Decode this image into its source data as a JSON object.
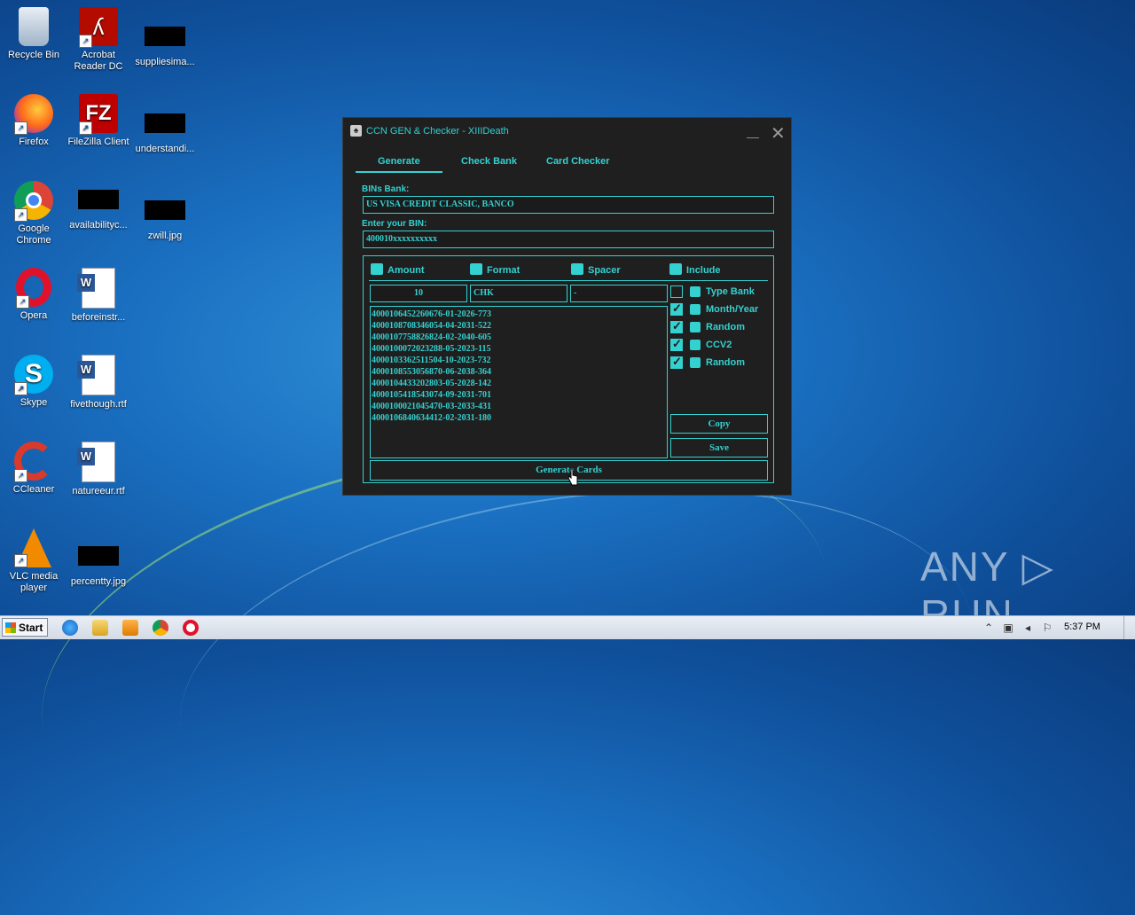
{
  "desktop": {
    "icons": [
      {
        "label": "Recycle Bin",
        "icon": "recycle-bin-icon"
      },
      {
        "label": "Acrobat Reader DC",
        "icon": "acrobat-icon"
      },
      {
        "label": "suppliesima...",
        "icon": "image-file-icon"
      },
      {
        "label": "Firefox",
        "icon": "firefox-icon"
      },
      {
        "label": "FileZilla Client",
        "icon": "filezilla-icon"
      },
      {
        "label": "understandi...",
        "icon": "image-file-icon"
      },
      {
        "label": "Google Chrome",
        "icon": "chrome-icon"
      },
      {
        "label": "availabilityc...",
        "icon": "image-file-icon"
      },
      {
        "label": "zwill.jpg",
        "icon": "image-file-icon"
      },
      {
        "label": "Opera",
        "icon": "opera-icon"
      },
      {
        "label": "beforeinstr...",
        "icon": "word-doc-icon"
      },
      {
        "label": "Skype",
        "icon": "skype-icon"
      },
      {
        "label": "fivethough.rtf",
        "icon": "word-doc-icon"
      },
      {
        "label": "CCleaner",
        "icon": "ccleaner-icon"
      },
      {
        "label": "natureeur.rtf",
        "icon": "word-doc-icon"
      },
      {
        "label": "VLC media player",
        "icon": "vlc-icon"
      },
      {
        "label": "percentty.jpg",
        "icon": "image-file-icon"
      }
    ],
    "watermark": "ANY ▷ RUN"
  },
  "window": {
    "title": "CCN GEN & Checker - XIIIDeath",
    "tabs": [
      "Generate",
      "Check Bank",
      "Card Checker"
    ],
    "bins_bank_label": "BINs Bank:",
    "bins_bank_value": "US VISA CREDIT CLASSIC, BANCO",
    "bin_label": "Enter your BIN:",
    "bin_value": "400010xxxxxxxxxx",
    "headers": {
      "amount": "Amount",
      "format": "Format",
      "spacer": "Spacer",
      "include": "Include"
    },
    "amount_value": "10",
    "format_value": "CHK",
    "spacer_value": "-",
    "options": [
      {
        "label": "Type Bank",
        "checked": false,
        "icon": "tag-icon"
      },
      {
        "label": "Month/Year",
        "checked": true,
        "icon": "calendar-icon"
      },
      {
        "label": "Random",
        "checked": true,
        "icon": "refresh-icon"
      },
      {
        "label": "CCV2",
        "checked": true,
        "icon": "gear-icon"
      },
      {
        "label": "Random",
        "checked": true,
        "icon": "refresh-icon"
      }
    ],
    "output_lines": [
      "4000106452260676-01-2026-773",
      "4000108708346054-04-2031-522",
      "4000107758826824-02-2040-605",
      "4000100072023288-05-2023-115",
      "4000103362511504-10-2023-732",
      "4000108553056870-06-2038-364",
      "4000104433202803-05-2028-142",
      "4000105418543074-09-2031-701",
      "4000100021045470-03-2033-431",
      "4000106840634412-02-2031-180"
    ],
    "copy_label": "Copy",
    "save_label": "Save",
    "generate_label": "Generate Cards",
    "accent": "#34d1d1"
  },
  "taskbar": {
    "start_label": "Start",
    "clock": "5:37 PM",
    "pinned": [
      "internet-explorer-icon",
      "file-explorer-icon",
      "media-player-icon",
      "chrome-icon",
      "opera-icon"
    ]
  }
}
